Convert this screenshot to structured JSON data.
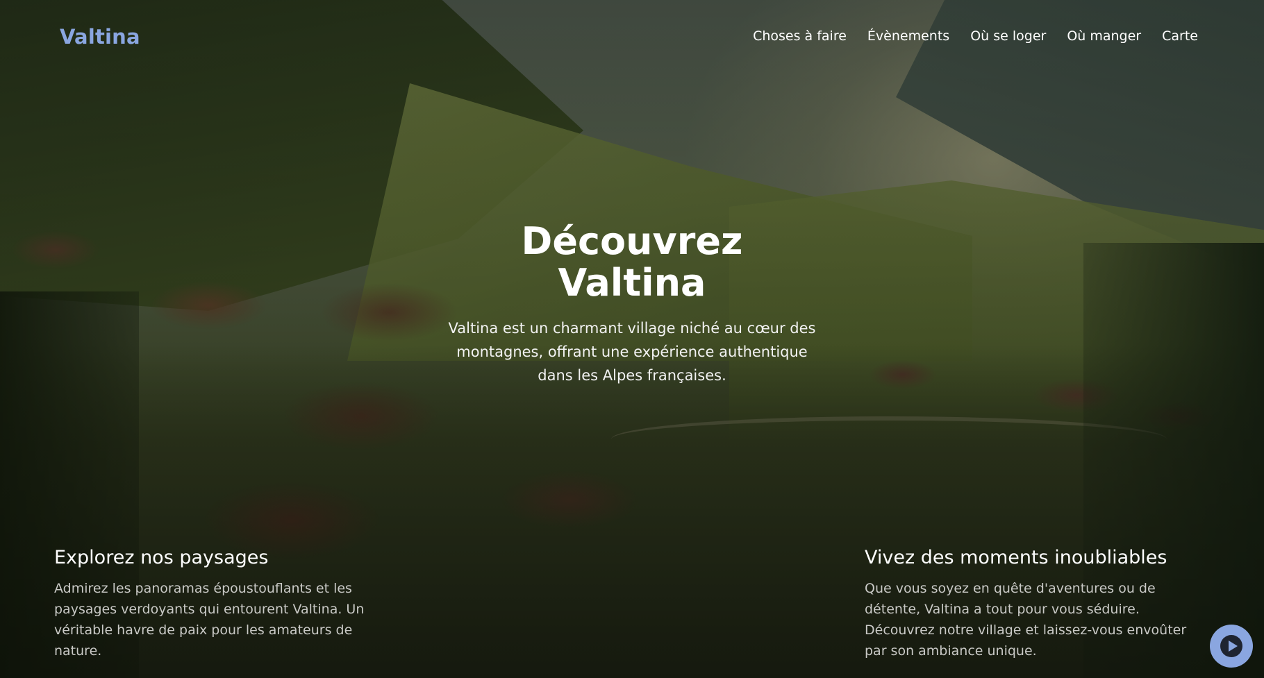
{
  "header": {
    "logo": "Valtina",
    "nav": [
      {
        "label": "Choses à faire"
      },
      {
        "label": "Évènements"
      },
      {
        "label": "Où se loger"
      },
      {
        "label": "Où manger"
      },
      {
        "label": "Carte"
      }
    ]
  },
  "hero": {
    "title_line1": "Découvrez",
    "title_line2": "Valtina",
    "description": "Valtina est un charmant village niché au cœur des montagnes, offrant une expérience authentique dans les Alpes françaises."
  },
  "features": [
    {
      "title": "Explorez nos paysages",
      "text": "Admirez les panoramas époustouflants et les paysages verdoyants qui entourent Valtina. Un véritable havre de paix pour les amateurs de nature."
    },
    {
      "title": "Vivez des moments inoubliables",
      "text": "Que vous soyez en quête d'aventures ou de détente, Valtina a tout pour vous séduire. Découvrez notre village et laissez-vous envoûter par son ambiance unique."
    }
  ],
  "media": {
    "play_icon": "play-icon"
  },
  "colors": {
    "brand": "#8aa6e0",
    "text": "#ffffff",
    "muted": "#c9c9c6"
  }
}
